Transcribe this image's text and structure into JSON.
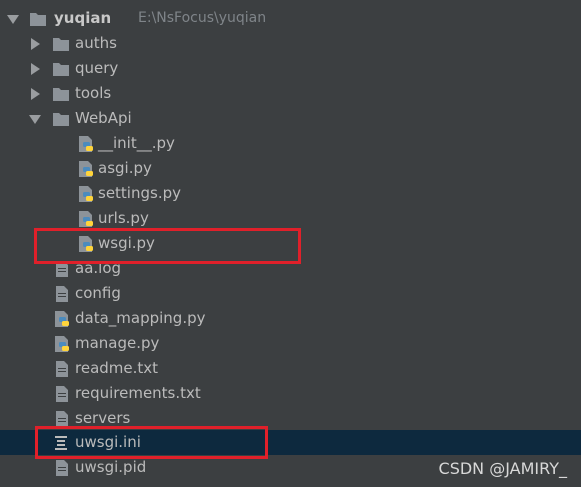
{
  "root": {
    "name": "yuqian",
    "path": "E:\\NsFocus\\yuqian"
  },
  "folders": [
    {
      "name": "auths",
      "expanded": false
    },
    {
      "name": "query",
      "expanded": false
    },
    {
      "name": "tools",
      "expanded": false
    },
    {
      "name": "WebApi",
      "expanded": true
    }
  ],
  "webapi_files": [
    {
      "name": "__init__.py",
      "icon": "python-file-icon"
    },
    {
      "name": "asgi.py",
      "icon": "python-file-icon"
    },
    {
      "name": "settings.py",
      "icon": "python-file-icon"
    },
    {
      "name": "urls.py",
      "icon": "python-file-icon"
    },
    {
      "name": "wsgi.py",
      "icon": "python-file-icon",
      "highlighted": true
    }
  ],
  "root_files": [
    {
      "name": "aa.log",
      "icon": "text-file-icon"
    },
    {
      "name": "config",
      "icon": "text-file-icon"
    },
    {
      "name": "data_mapping.py",
      "icon": "python-file-icon"
    },
    {
      "name": "manage.py",
      "icon": "python-file-icon"
    },
    {
      "name": "readme.txt",
      "icon": "text-file-icon"
    },
    {
      "name": "requirements.txt",
      "icon": "text-file-icon"
    },
    {
      "name": "servers",
      "icon": "text-file-icon"
    },
    {
      "name": "uwsgi.ini",
      "icon": "ini-file-icon",
      "selected": true,
      "highlighted": true
    },
    {
      "name": "uwsgi.pid",
      "icon": "text-file-icon"
    }
  ],
  "watermark": "CSDN @JAMIRY_",
  "colors": {
    "background": "#3c3f41",
    "selection": "#0d293e",
    "highlight_box": "#e0202a",
    "text": "#bbbbbb",
    "folder": "#8d9399",
    "python_blue": "#4b8bbe",
    "python_yellow": "#ffd43b"
  }
}
